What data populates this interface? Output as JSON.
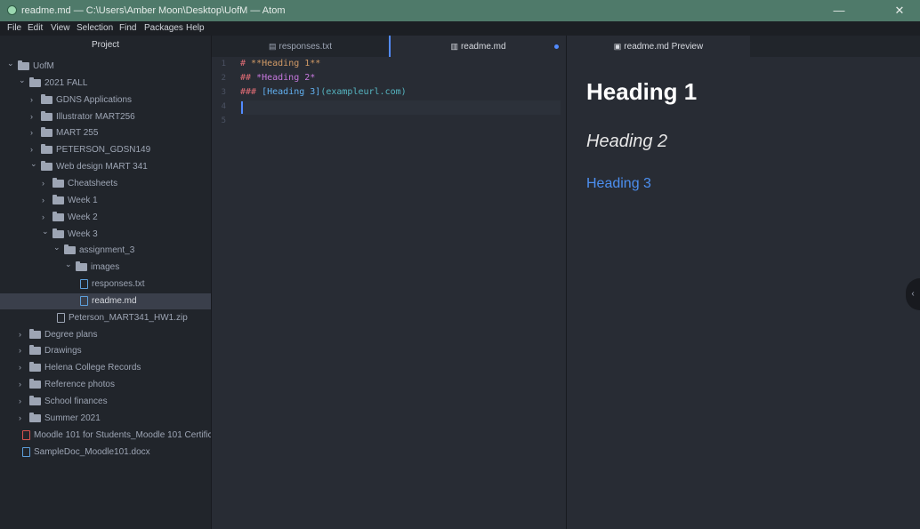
{
  "titlebar": {
    "title": "readme.md — C:\\Users\\Amber Moon\\Desktop\\UofM — Atom",
    "minimize": "—",
    "close": "✕"
  },
  "menu": [
    "File",
    "Edit",
    "View",
    "Selection",
    "Find",
    "Packages",
    "Help"
  ],
  "sidebar": {
    "header": "Project",
    "tree": [
      {
        "label": "UofM",
        "type": "folder",
        "expanded": true,
        "depth": 0
      },
      {
        "label": "2021 FALL",
        "type": "folder",
        "expanded": true,
        "depth": 1
      },
      {
        "label": "GDNS Applications",
        "type": "folder",
        "expanded": false,
        "depth": 2
      },
      {
        "label": "Illustrator MART256",
        "type": "folder",
        "expanded": false,
        "depth": 2
      },
      {
        "label": "MART 255",
        "type": "folder",
        "expanded": false,
        "depth": 2
      },
      {
        "label": "PETERSON_GDSN149",
        "type": "folder",
        "expanded": false,
        "depth": 2
      },
      {
        "label": "Web design MART 341",
        "type": "folder",
        "expanded": true,
        "depth": 2
      },
      {
        "label": "Cheatsheets",
        "type": "folder",
        "expanded": false,
        "depth": 3
      },
      {
        "label": "Week 1",
        "type": "folder",
        "expanded": false,
        "depth": 3
      },
      {
        "label": "Week 2",
        "type": "folder",
        "expanded": false,
        "depth": 3
      },
      {
        "label": "Week 3",
        "type": "folder",
        "expanded": true,
        "depth": 3
      },
      {
        "label": "assignment_3",
        "type": "folder",
        "expanded": true,
        "depth": 4
      },
      {
        "label": "images",
        "type": "folder",
        "expanded": true,
        "depth": 5
      },
      {
        "label": "responses.txt",
        "type": "file",
        "depth": 6
      },
      {
        "label": "readme.md",
        "type": "file",
        "depth": 6,
        "selected": true
      },
      {
        "label": "Peterson_MART341_HW1.zip",
        "type": "file",
        "depth": 4
      },
      {
        "label": "Degree plans",
        "type": "folder",
        "expanded": false,
        "depth": 1
      },
      {
        "label": "Drawings",
        "type": "folder",
        "expanded": false,
        "depth": 1
      },
      {
        "label": "Helena College Records",
        "type": "folder",
        "expanded": false,
        "depth": 1
      },
      {
        "label": "Reference photos",
        "type": "folder",
        "expanded": false,
        "depth": 1
      },
      {
        "label": "School finances",
        "type": "folder",
        "expanded": false,
        "depth": 1
      },
      {
        "label": "Summer 2021",
        "type": "folder",
        "expanded": false,
        "depth": 1
      },
      {
        "label": "Moodle 101 for Students_Moodle 101 Certific",
        "type": "file-pdf",
        "depth": 1
      },
      {
        "label": "SampleDoc_Moodle101.docx",
        "type": "file-doc",
        "depth": 1
      }
    ]
  },
  "tabs": {
    "left": [
      {
        "label": "responses.txt",
        "active": false
      },
      {
        "label": "readme.md",
        "active": true,
        "modified": true
      }
    ],
    "right": [
      {
        "label": "readme.md Preview",
        "active": true
      }
    ]
  },
  "editor": {
    "line_numbers": [
      "1",
      "2",
      "3",
      "4",
      "5"
    ],
    "lines": [
      [
        {
          "t": "# ",
          "c": "#e06c75"
        },
        {
          "t": "**Heading 1**",
          "c": "#d19a66"
        }
      ],
      [
        {
          "t": "## ",
          "c": "#e06c75"
        },
        {
          "t": "*Heading 2*",
          "c": "#c678dd"
        }
      ],
      [
        {
          "t": "### ",
          "c": "#e06c75"
        },
        {
          "t": "[Heading 3]",
          "c": "#61afef"
        },
        {
          "t": "(exampleurl.com)",
          "c": "#56b6c2"
        }
      ],
      [],
      []
    ]
  },
  "preview": {
    "h1": "Heading 1",
    "h2": "Heading 2",
    "h3": "Heading 3"
  },
  "colors": {
    "titlebar": "#4f7a6a",
    "accent": "#528bff",
    "link": "#4c8ff0"
  }
}
